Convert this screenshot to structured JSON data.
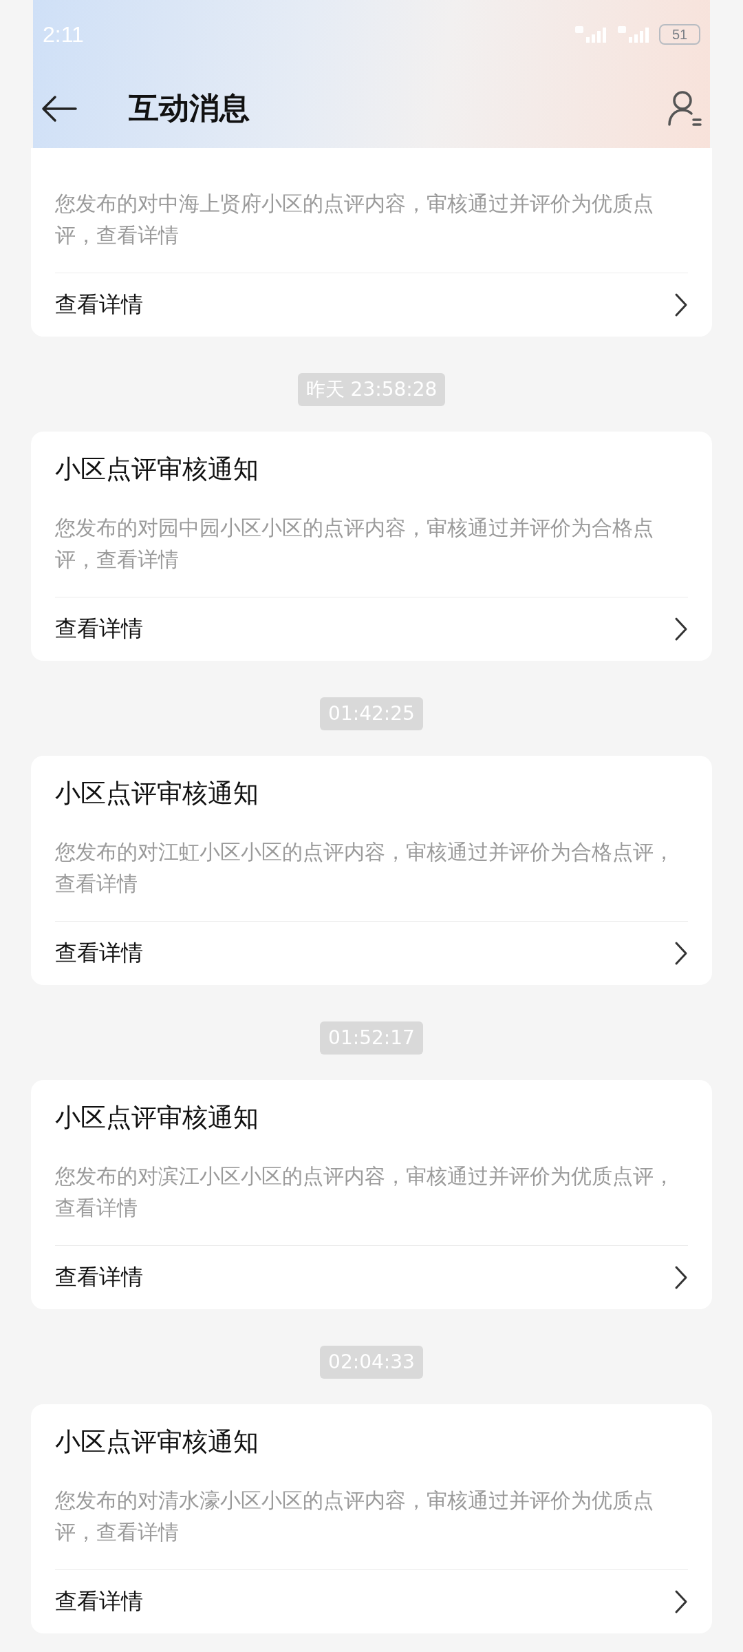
{
  "status_bar": {
    "time": "2:11",
    "battery": "51"
  },
  "header": {
    "title": "互动消息"
  },
  "messages": [
    {
      "body": "您发布的对中海上贤府小区的点评内容，审核通过并评价为优质点评，查看详情",
      "link": "查看详情"
    },
    {
      "timestamp": "昨天 23:58:28",
      "title": "小区点评审核通知",
      "body": "您发布的对园中园小区小区的点评内容，审核通过并评价为合格点评，查看详情",
      "link": "查看详情"
    },
    {
      "timestamp": "01:42:25",
      "title": "小区点评审核通知",
      "body": "您发布的对江虹小区小区的点评内容，审核通过并评价为合格点评，查看详情",
      "link": "查看详情"
    },
    {
      "timestamp": "01:52:17",
      "title": "小区点评审核通知",
      "body": "您发布的对滨江小区小区的点评内容，审核通过并评价为优质点评，查看详情",
      "link": "查看详情"
    },
    {
      "timestamp": "02:04:33",
      "title": "小区点评审核通知",
      "body": "您发布的对清水濠小区小区的点评内容，审核通过并评价为优质点评，查看详情",
      "link": "查看详情"
    }
  ]
}
